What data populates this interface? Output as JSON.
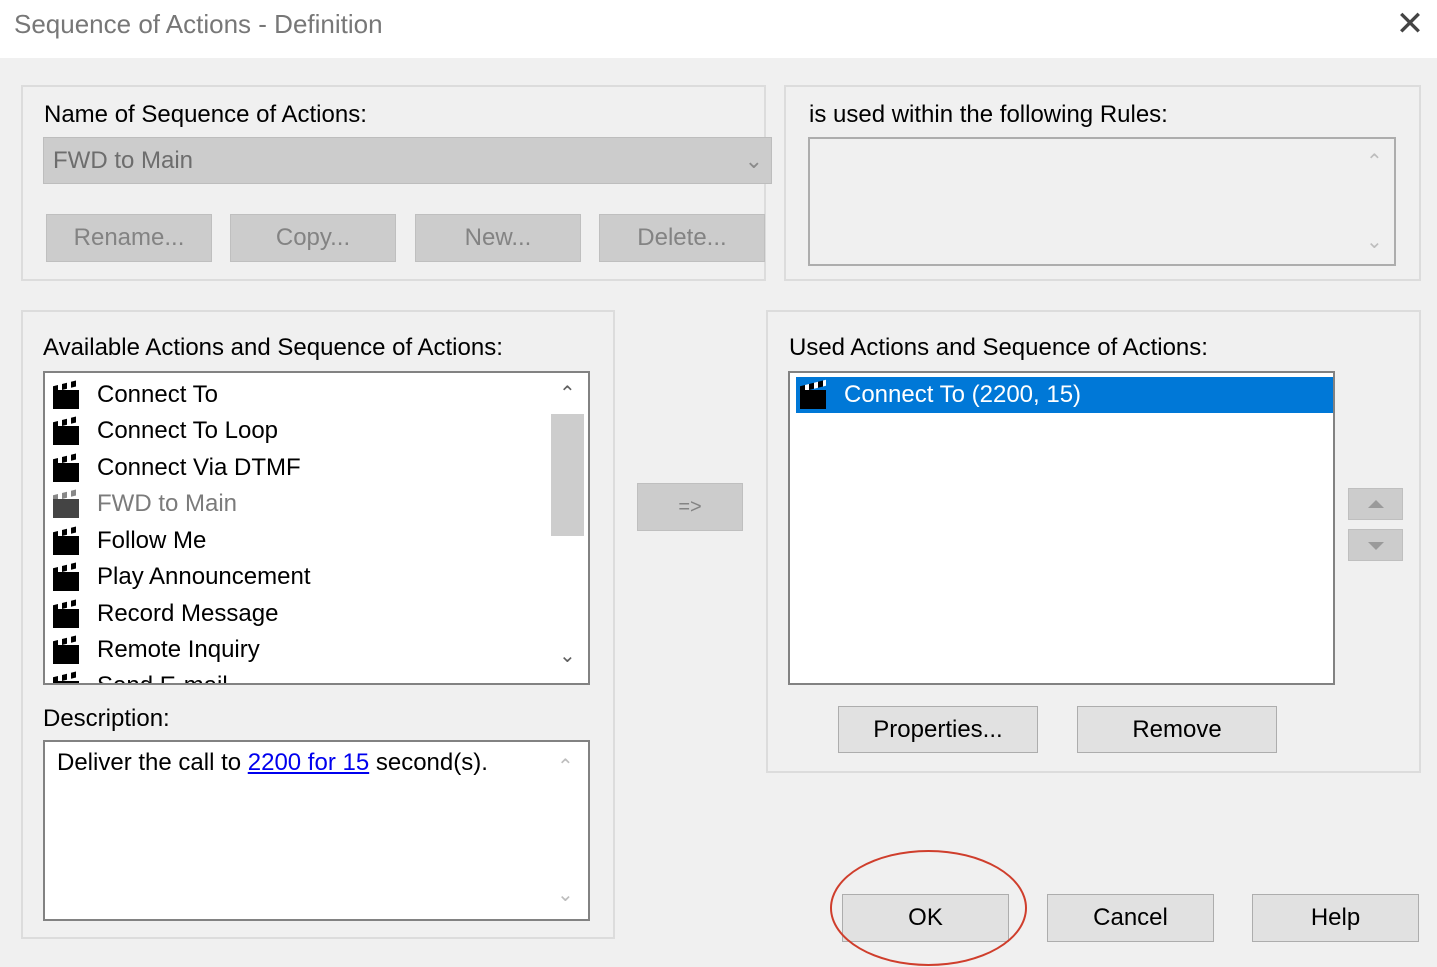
{
  "window": {
    "title": "Sequence of Actions - Definition",
    "close_symbol": "✕"
  },
  "name_section": {
    "label": "Name of Sequence of Actions:",
    "combo_value": "FWD to Main",
    "buttons": {
      "rename": "Rename...",
      "copy": "Copy...",
      "new": "New...",
      "delete": "Delete..."
    }
  },
  "rules_section": {
    "label": "is used within the following Rules:",
    "items": []
  },
  "available": {
    "label": "Available Actions and Sequence of Actions:",
    "items": [
      {
        "label": "Connect To",
        "icon": "clapperboard-icon",
        "enabled": true
      },
      {
        "label": "Connect To Loop",
        "icon": "clapperboard-icon",
        "enabled": true
      },
      {
        "label": "Connect Via DTMF",
        "icon": "clapperboard-icon",
        "enabled": true
      },
      {
        "label": "FWD to Main",
        "icon": "clapperboard-icon",
        "enabled": false
      },
      {
        "label": "Follow Me",
        "icon": "clapperboard-icon",
        "enabled": true
      },
      {
        "label": "Play Announcement",
        "icon": "clapperboard-icon",
        "enabled": true
      },
      {
        "label": "Record Message",
        "icon": "clapperboard-icon",
        "enabled": true
      },
      {
        "label": "Remote Inquiry",
        "icon": "clapperboard-icon",
        "enabled": true
      },
      {
        "label": "Send E-mail",
        "icon": "clapperboard-icon",
        "enabled": true
      }
    ]
  },
  "transfer_button": "=>",
  "used": {
    "label": "Used Actions and Sequence of Actions:",
    "items": [
      {
        "label": "Connect To (2200, 15)",
        "selected": true
      }
    ],
    "properties_button": "Properties...",
    "remove_button": "Remove"
  },
  "description": {
    "label": "Description:",
    "prefix": "Deliver the call to ",
    "link": "2200 for 15",
    "suffix": " second(s)."
  },
  "footer": {
    "ok": "OK",
    "cancel": "Cancel",
    "help": "Help"
  },
  "colors": {
    "selection": "#0078d7",
    "annotation": "#cf3e2c",
    "link": "#0000ee"
  }
}
